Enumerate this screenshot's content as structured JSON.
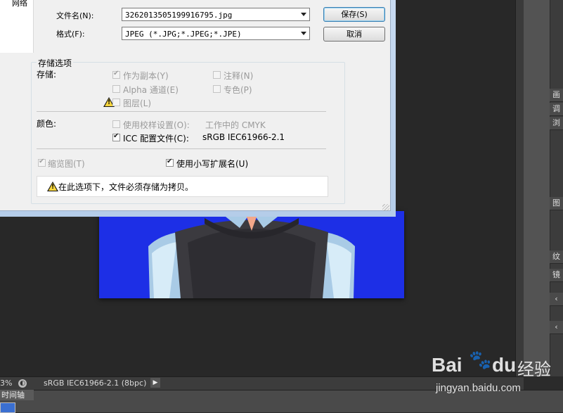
{
  "dialog": {
    "nav_item": "网络",
    "filename_label": "文件名(N):",
    "filename_value": "3262013505199916795.jpg",
    "format_label": "格式(F):",
    "format_value": "JPEG (*.JPG;*.JPEG;*.JPE)",
    "save_button": "保存(S)",
    "cancel_button": "取消",
    "options_title": "存储选项",
    "storage_label": "存储:",
    "opt_as_copy": "作为副本(Y)",
    "opt_notes": "注释(N)",
    "opt_alpha": "Alpha 通道(E)",
    "opt_spot": "专色(P)",
    "opt_layers": "图层(L)",
    "color_label": "颜色:",
    "opt_proof": "使用校样设置(O):",
    "opt_proof_value": "工作中的 CMYK",
    "opt_icc": "ICC 配置文件(C):",
    "opt_icc_value": "sRGB IEC61966-2.1",
    "opt_thumbnail": "缩览图(T)",
    "opt_lowercase_ext": "使用小写扩展名(U)",
    "warning_text": "在此选项下，文件必须存储为拷贝。"
  },
  "status": {
    "zoom": "3%",
    "profile": "sRGB IEC61966-2.1 (8bpc)"
  },
  "timeline": {
    "tab": "时间轴"
  },
  "right_panel": {
    "labels": [
      "画",
      "调",
      "浏",
      "图",
      "纹",
      "镜"
    ]
  },
  "watermark": {
    "brand": "Bai",
    "brand2": "du",
    "cn": "经验",
    "url": "jingyan.baidu.com"
  },
  "colors": {
    "doc_blue": "#1d2fe6",
    "dialog_bg": "#f0f0f0",
    "workspace": "#282828"
  }
}
